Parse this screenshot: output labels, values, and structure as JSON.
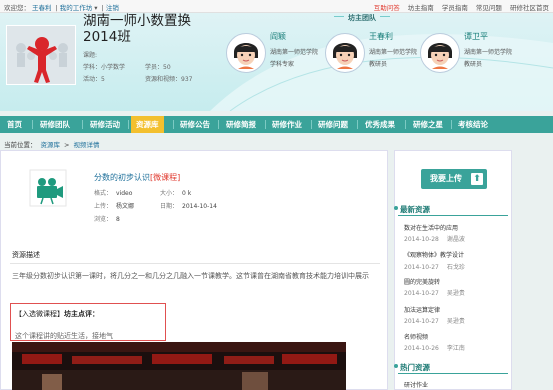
{
  "topbar": {
    "welcome": "欢迎您：",
    "user": "王春利",
    "my_work": "我的工作坊",
    "logout": "注销",
    "links": [
      "互助问答",
      "坊主指南",
      "学员指南",
      "常见问题",
      "研修社区首页"
    ]
  },
  "team": {
    "title": "湖南一师小数置换2014班",
    "stats": {
      "topic_label": "课题:",
      "topic_value": "",
      "subject_label": "学科：",
      "subject_value": "小学数学",
      "student_label": "学员：",
      "student_value": "50",
      "activity_label": "活动：",
      "activity_value": "5",
      "resource_label": "资源和视频：",
      "resource_value": "937"
    }
  },
  "leaders": {
    "heading": "坊主团队",
    "members": [
      {
        "name": "阎颖",
        "org": "湖南第一师范学院",
        "role": "学科专家"
      },
      {
        "name": "王春利",
        "org": "湖南第一师范学院",
        "role": "教研员"
      },
      {
        "name": "谭卫平",
        "org": "湖南第一师范学院",
        "role": "教研员"
      }
    ]
  },
  "nav": {
    "items": [
      "首页",
      "研修团队",
      "研修活动",
      "资源库",
      "研修公告",
      "研修简报",
      "研修作业",
      "研修问题",
      "优秀成果",
      "研修之星",
      "考核结论"
    ],
    "active": "资源库"
  },
  "breadcrumb": {
    "prefix": "当前位置：",
    "items": [
      "资源库",
      "视频详情"
    ],
    "sep": ">"
  },
  "video": {
    "title": "分数的初步认识",
    "tag": "[微课程]",
    "format_label": "格式：",
    "format_value": "video",
    "size_label": "大小：",
    "size_value": "0 k",
    "uploader_label": "上传：",
    "uploader_value": "杨文娜",
    "date_label": "日期：",
    "date_value": "2014-10-14",
    "views_label": "浏览：",
    "views_value": "8"
  },
  "description": {
    "heading": "资源描述",
    "text": "三年级分数初步认识第一课时，将几分之一和几分之几融入一节课教学。这节课曾在湖南省教育技术能力培训中展示",
    "review_title": "【入选微课程】",
    "review_suffix": "坊主点评：",
    "review_text": "这个课程讲的贴近生活，接地气"
  },
  "sidebar": {
    "upload_label": "我要上传",
    "upload_arrow": "⬆",
    "latest_heading": "最新资源",
    "latest": [
      {
        "title": "数对在生活中的应用",
        "date": "2014-10-28",
        "author": "谢晶波"
      },
      {
        "title": "《观察物体》教学设计",
        "date": "2014-10-27",
        "author": "石戈珍"
      },
      {
        "title": "圆的完美旋转",
        "date": "2014-10-27",
        "author": "吴逊贵"
      },
      {
        "title": "加法运算定律",
        "date": "2014-10-27",
        "author": "吴逊贵"
      },
      {
        "title": "名师视频",
        "date": "2014-10-26",
        "author": "李江南"
      }
    ],
    "hot_heading": "热门资源",
    "hot": [
      {
        "title": "研讨作业"
      }
    ]
  },
  "colors": {
    "nav_bg": "#3aa39a",
    "nav_active": "#f3c02e",
    "link": "#1d6f9a",
    "accent_red": "#e03a2f",
    "header_bg": "#d2f0f2"
  }
}
